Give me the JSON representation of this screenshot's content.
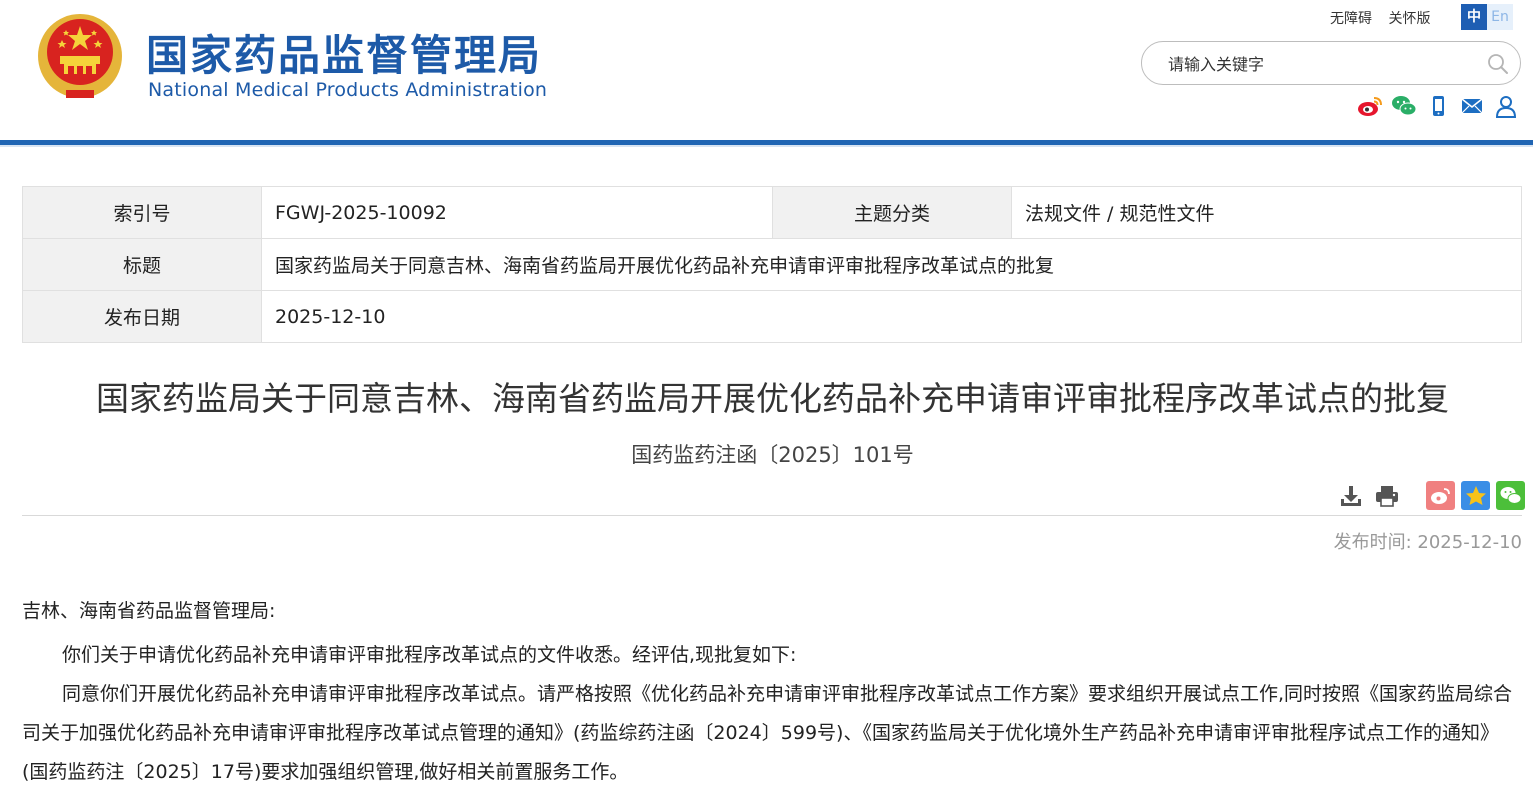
{
  "header": {
    "logo_cn": "国家药品监督管理局",
    "logo_en": "National Medical Products Administration",
    "links": [
      "无障碍",
      "关怀版"
    ],
    "lang_zh": "中",
    "lang_en": "En",
    "search_placeholder": "请输入关键字",
    "icons": [
      "weibo-icon",
      "wechat-icon",
      "mobile-icon",
      "mail-icon",
      "user-icon"
    ],
    "accent_color": "#1d5aa8"
  },
  "meta": {
    "index_label": "索引号",
    "index_value": "FGWJ-2025-10092",
    "category_label": "主题分类",
    "category_value": "法规文件 / 规范性文件",
    "title_label": "标题",
    "title_value": "国家药监局关于同意吉林、海南省药监局开展优化药品补充申请审评审批程序改革试点的批复",
    "date_label": "发布日期",
    "date_value": "2025-12-10"
  },
  "doc": {
    "title": "国家药监局关于同意吉林、海南省药监局开展优化药品补充申请审评审批程序改革试点的批复",
    "number": "国药监药注函〔2025〕101号",
    "publish_label": "发布时间:",
    "publish_date": "2025-12-10",
    "tools": [
      "download-icon",
      "print-icon"
    ],
    "share": [
      "weibo-share-icon",
      "qzone-share-icon",
      "wechat-share-icon"
    ]
  },
  "body": {
    "salutation": "吉林、海南省药品监督管理局:",
    "paragraphs": [
      "你们关于申请优化药品补充申请审评审批程序改革试点的文件收悉。经评估,现批复如下:",
      "同意你们开展优化药品补充申请审评审批程序改革试点。请严格按照《优化药品补充申请审评审批程序改革试点工作方案》要求组织开展试点工作,同时按照《国家药监局综合司关于加强优化药品补充申请审评审批程序改革试点管理的通知》(药监综药注函〔2024〕599号)、《国家药监局关于优化境外生产药品补充申请审评审批程序试点工作的通知》(国药监药注〔2025〕17号)要求加强组织管理,做好相关前置服务工作。"
    ]
  }
}
